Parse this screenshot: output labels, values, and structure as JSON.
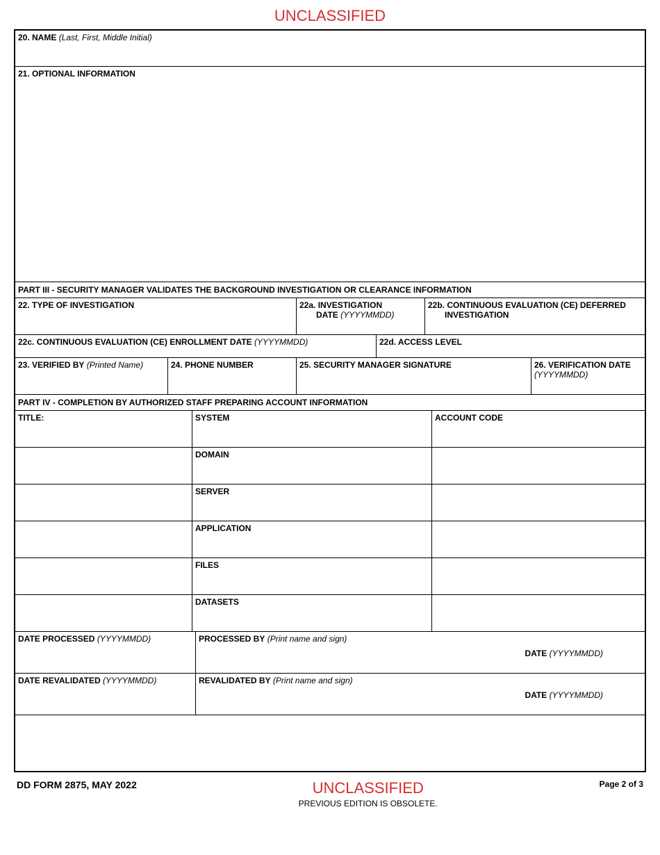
{
  "classification": "UNCLASSIFIED",
  "fields": {
    "name_label": "20. NAME",
    "name_hint": "(Last, First, Middle Initial)",
    "optional_info_label": "21. OPTIONAL INFORMATION"
  },
  "part3": {
    "header": "PART III - SECURITY MANAGER VALIDATES THE BACKGROUND INVESTIGATION OR CLEARANCE INFORMATION",
    "type_investigation": "22. TYPE OF INVESTIGATION",
    "investigation_date_label": "22a. INVESTIGATION",
    "investigation_date_sub": "DATE",
    "investigation_date_hint": "(YYYYMMDD)",
    "ce_deferred_label": "22b. CONTINUOUS EVALUATION (CE) DEFERRED",
    "ce_deferred_sub": "INVESTIGATION",
    "ce_enrollment_label": "22c. CONTINUOUS EVALUATION (CE) ENROLLMENT DATE",
    "ce_enrollment_hint": "(YYYYMMDD)",
    "access_level": "22d. ACCESS LEVEL",
    "verified_by_label": "23. VERIFIED BY",
    "verified_by_hint": "(Printed Name)",
    "phone_number": "24. PHONE NUMBER",
    "security_signature": "25. SECURITY MANAGER SIGNATURE",
    "verification_date_label": "26. VERIFICATION DATE",
    "verification_date_hint": "(YYYYMMDD)"
  },
  "part4": {
    "header": "PART IV - COMPLETION BY AUTHORIZED STAFF PREPARING ACCOUNT INFORMATION",
    "title": "TITLE:",
    "system": "SYSTEM",
    "account_code": "ACCOUNT CODE",
    "domain": "DOMAIN",
    "server": "SERVER",
    "application": "APPLICATION",
    "files": "FILES",
    "datasets": "DATASETS",
    "date_processed_label": "DATE PROCESSED",
    "date_processed_hint": "(YYYYMMDD)",
    "processed_by_label": "PROCESSED BY",
    "processed_by_hint": "(Print name and sign)",
    "date_label": "DATE",
    "date_hint": "(YYYYMMDD)",
    "date_revalidated_label": "DATE REVALIDATED",
    "date_revalidated_hint": "(YYYYMMDD)",
    "revalidated_by_label": "REVALIDATED BY",
    "revalidated_by_hint": "(Print name and sign)"
  },
  "footer": {
    "form_id": "DD FORM 2875, MAY 2022",
    "classification": "UNCLASSIFIED",
    "obsolete": "PREVIOUS EDITION IS OBSOLETE.",
    "page": "Page 2 of 3"
  }
}
